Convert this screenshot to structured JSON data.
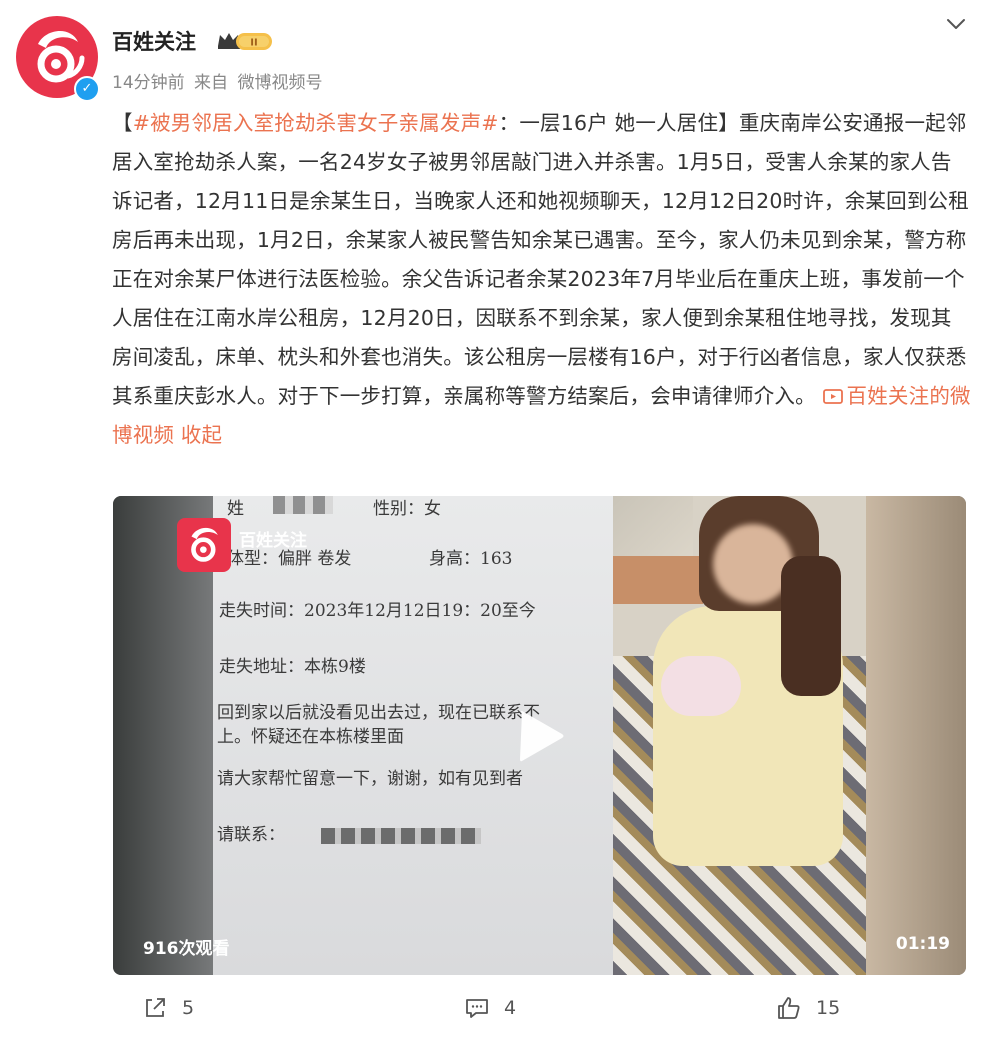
{
  "user": {
    "name": "百姓关注",
    "vip_level": "II",
    "time": "14分钟前",
    "source_prefix": "来自",
    "source": "微博视频号"
  },
  "post": {
    "bracket_open": "【",
    "topic": "#被男邻居入室抢劫杀害女子亲属发声#",
    "headline": "：一层16户 她一人居住】",
    "body": "重庆南岸公安通报一起邻居入室抢劫杀人案，一名24岁女子被男邻居敲门进入并杀害。1月5日，受害人余某的家人告诉记者，12月11日是余某生日，当晚家人还和她视频聊天，12月12日20时许，余某回到公租房后再未出现，1月2日，余某家人被民警告知余某已遇害。至今，家人仍未见到余某，警方称正在对余某尸体进行法医检验。余父告诉记者余某2023年7月毕业后在重庆上班，事发前一个人居住在江南水岸公租房，12月20日，因联系不到余某，家人便到余某租住地寻找，发现其房间凌乱，床单、枕头和外套也消失。该公租房一层楼有16户，对于行凶者信息，家人仅获悉其系重庆彭水人。对于下一步打算，亲属称等警方结案后，会申请律师介入。",
    "video_link": "百姓关注的微博视频",
    "collapse": "收起"
  },
  "video": {
    "logo_text": "百姓关注",
    "doc_lines": [
      "姓",
      "性别：女",
      "体型：偏胖    卷发",
      "身高：163",
      "走失时间：2023年12月12日19：20至今",
      "走失地址：本栋9楼",
      "回到家以后就没看见出去过，现在已联系不",
      "上。怀疑还在本栋楼里面",
      "请大家帮忙留意一下，谢谢，如有见到者",
      "请联系："
    ],
    "views": "916次观看",
    "duration": "01:19"
  },
  "actions": {
    "share_count": "5",
    "comment_count": "4",
    "like_count": "15"
  },
  "colors": {
    "accent": "#eb7350",
    "brand": "#e8344b",
    "verified": "#1f9ff0"
  }
}
